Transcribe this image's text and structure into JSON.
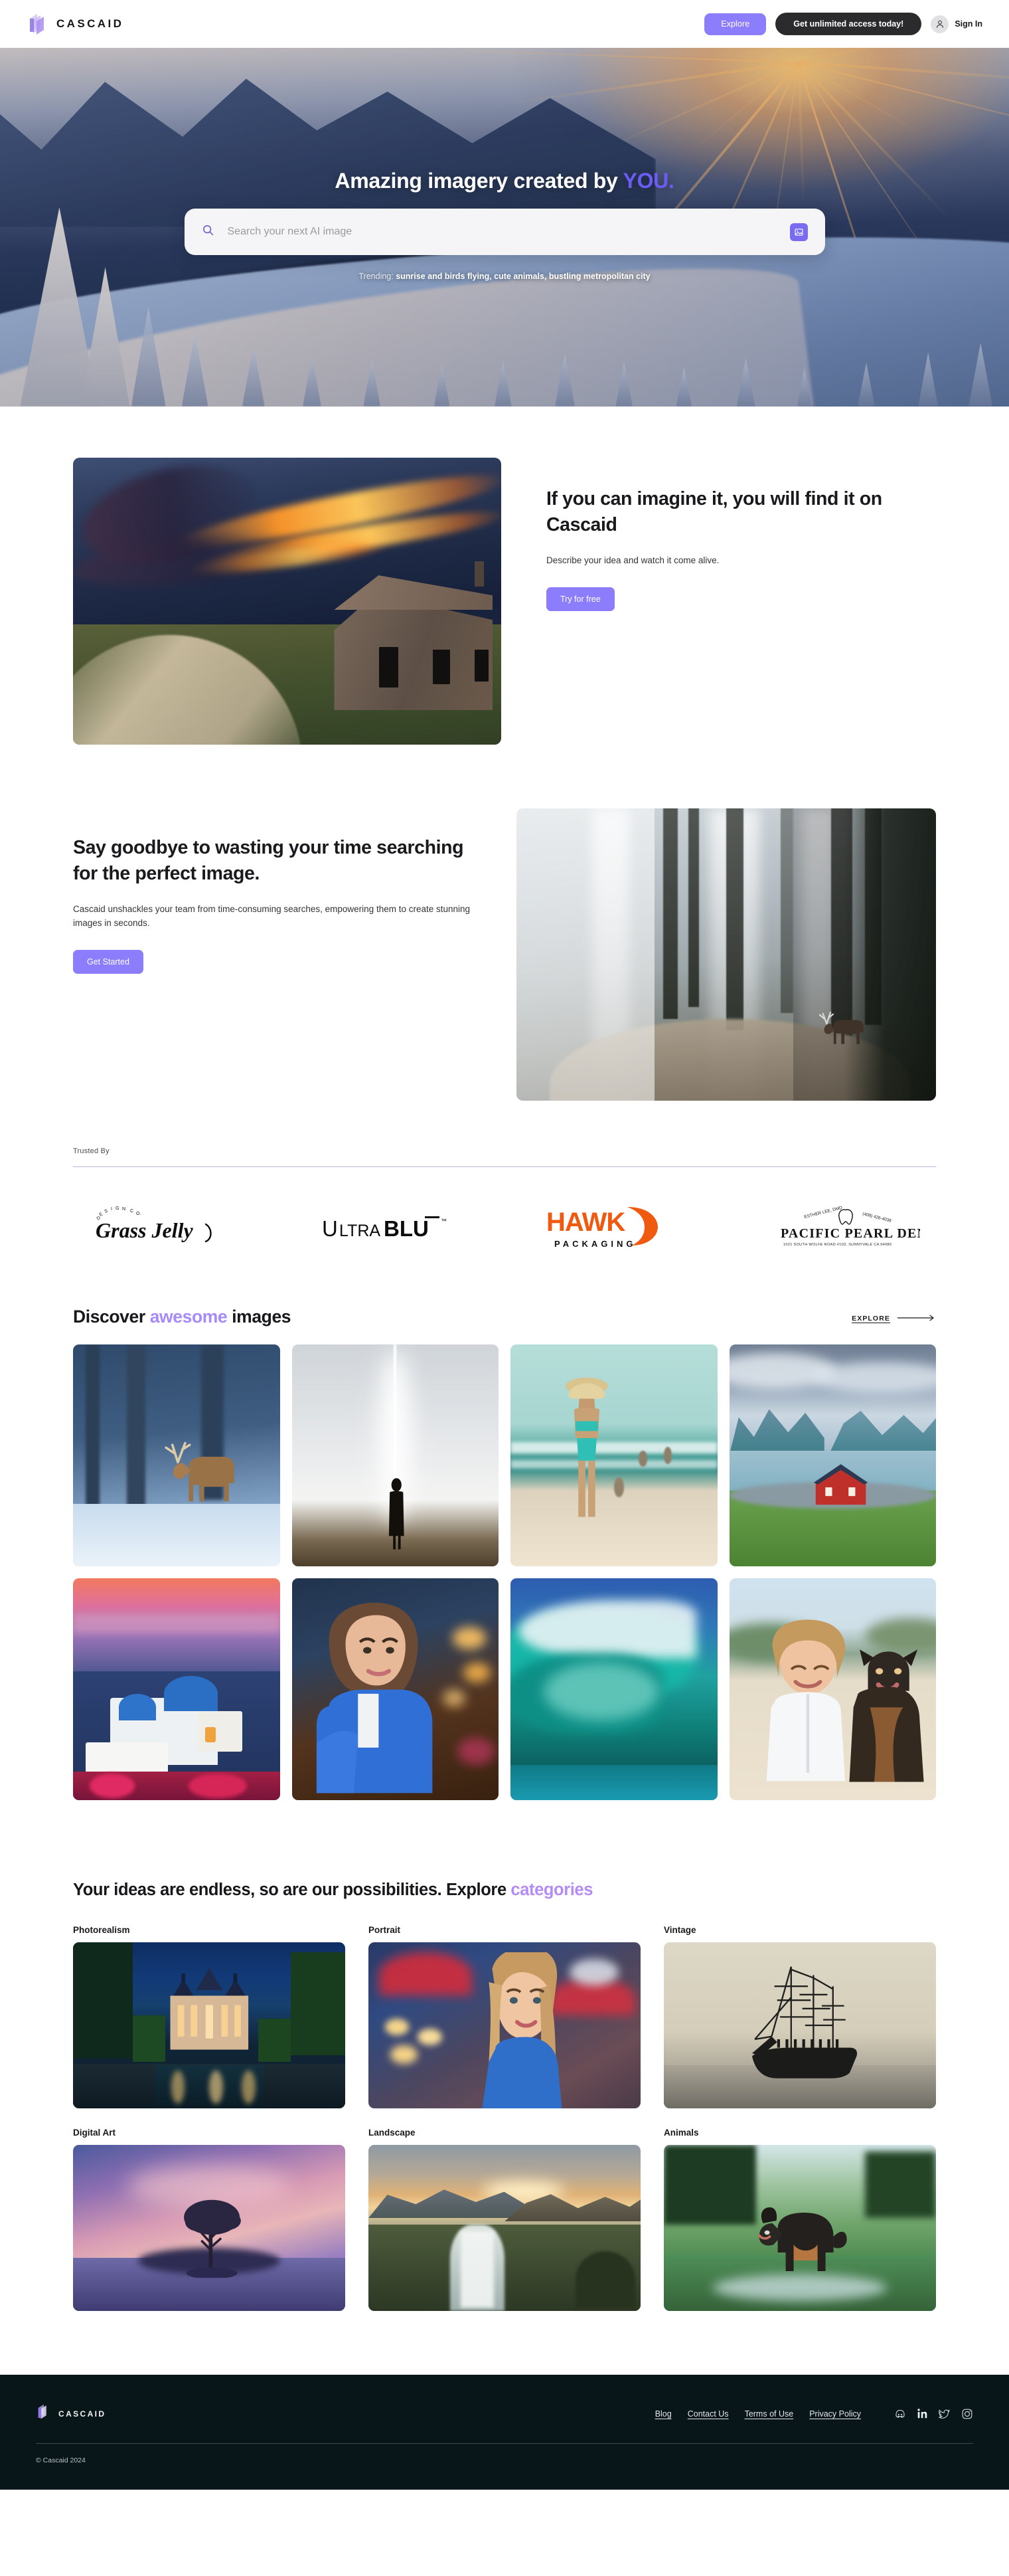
{
  "brand": {
    "name": "CASCAID",
    "logo_icon": "cascaid-layers-logo"
  },
  "header": {
    "explore_label": "Explore",
    "unlimited_label": "Get unlimited access today!",
    "signin_label": "Sign In",
    "user_icon": "user-icon"
  },
  "hero": {
    "title_main": "Amazing imagery created by ",
    "title_accent": "YOU.",
    "search_placeholder": "Search your next AI image",
    "search_value": "",
    "search_icon": "search-icon",
    "upload_icon": "image-upload-icon",
    "trending_label": "Trending: ",
    "trending_terms": "sunrise and birds flying, cute animals, bustling metropolitan city",
    "background_alt": "snowy winter landscape with sunburst"
  },
  "imagine": {
    "heading": "If you can imagine it, you will find it on Cascaid",
    "subtext": "Describe your idea and watch it come alive.",
    "cta_label": "Try for free",
    "image_alt": "abandoned cabin at sunset with dirt road"
  },
  "goodbye": {
    "heading": "Say goodbye to wasting your time searching for the perfect image.",
    "subtext": "Cascaid unshackles your team from time-consuming searches, empowering them to create stunning images in seconds.",
    "cta_label": "Get Started",
    "image_alt": "deer in misty forest"
  },
  "trusted": {
    "label": "Trusted By",
    "logos": [
      {
        "name": "Grass Jelly",
        "sub": "DESIGN CO."
      },
      {
        "name": "ULTRABLU",
        "sub": ""
      },
      {
        "name": "HAWK",
        "sub": "PACKAGING"
      },
      {
        "name": "PACIFIC PEARL DENTAL",
        "sub": "1021 SOUTH WOLFE ROAD #103, SUNNYVALE CA 94086"
      }
    ]
  },
  "discover": {
    "heading_pre": "Discover ",
    "heading_accent": "awesome",
    "heading_post": " images",
    "explore_label": "EXPLORE",
    "arrow_icon": "arrow-right-icon",
    "tiles": [
      {
        "alt": "deer in snowy blue forest"
      },
      {
        "alt": "silhouette person under bright light beam"
      },
      {
        "alt": "woman in turquoise bikini on beach"
      },
      {
        "alt": "red cabin by fjord lake"
      },
      {
        "alt": "santorini blue domes at sunset"
      },
      {
        "alt": "woman in blue jacket at cafe"
      },
      {
        "alt": "large turquoise ocean wave"
      },
      {
        "alt": "smiling woman with dog on beach"
      }
    ]
  },
  "categories": {
    "heading_pre": "Your ideas are endless, so are our possibilities. Explore ",
    "heading_accent": "categories",
    "items": [
      {
        "label": "Photorealism",
        "alt": "illuminated chateau at night with reflecting pool"
      },
      {
        "label": "Portrait",
        "alt": "blonde woman portrait with red umbrellas bokeh"
      },
      {
        "label": "Vintage",
        "alt": "black and white tall ship sailing vessel"
      },
      {
        "label": "Digital Art",
        "alt": "lone tree on island at pink dusk"
      },
      {
        "label": "Landscape",
        "alt": "waterfall and mountains at sunrise"
      },
      {
        "label": "Animals",
        "alt": "dog running through water in green field"
      }
    ]
  },
  "footer": {
    "brand_name": "CASCAID",
    "links": [
      "Blog",
      "Contact Us",
      "Terms of Use",
      "Privacy Policy"
    ],
    "socials": [
      "discord-icon",
      "linkedin-icon",
      "twitter-icon",
      "instagram-icon"
    ],
    "copyright": "© Cascaid 2024"
  },
  "colors": {
    "purple": "#8b7dfb",
    "purple_accent": "#6c5cf5",
    "lilac": "#a78bfa",
    "dark": "#2b2b2d",
    "footer_bg": "#081519"
  }
}
